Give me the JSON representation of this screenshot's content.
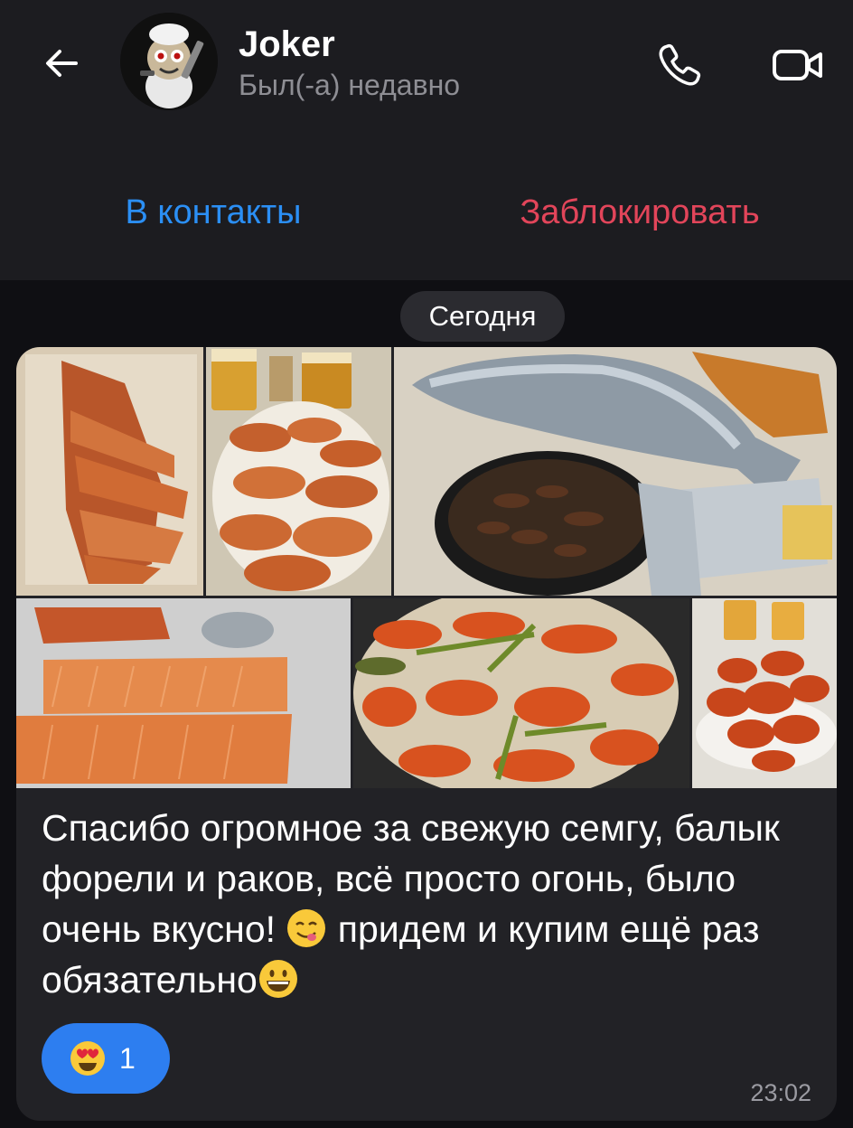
{
  "header": {
    "title": "Joker",
    "status": "Был(-а) недавно",
    "add_contact": "В контакты",
    "block": "Заблокировать"
  },
  "date_chip": "Сегодня",
  "message": {
    "text_part1": "Спасибо огромное за свежую семгу, балык форели и раков, всё просто огонь, было очень вкусно! ",
    "text_part2": " придем и купим ещё раз обязательно",
    "photo_count": 6,
    "reaction_count": "1",
    "time": "23:02"
  },
  "icons": [
    "back-arrow-icon",
    "phone-icon",
    "video-camera-icon",
    "yum-face-emoji",
    "grinning-face-emoji",
    "heart-eyes-emoji"
  ],
  "colors": {
    "accent_blue": "#2b8ff5",
    "danger_red": "#e2455a",
    "reaction_bg": "#2d7ef0"
  }
}
